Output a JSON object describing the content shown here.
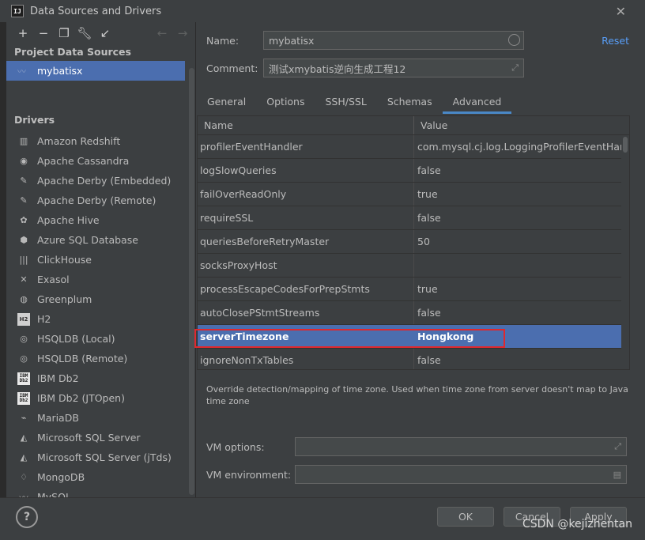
{
  "window": {
    "title": "Data Sources and Drivers",
    "app_icon": "IJ"
  },
  "toolbar": {
    "icons": [
      "add-icon",
      "remove-icon",
      "duplicate-icon",
      "wrench-icon",
      "import-icon",
      "back-icon",
      "forward-icon"
    ]
  },
  "sidebar": {
    "project_heading": "Project Data Sources",
    "data_source": "mybatisx",
    "drivers_heading": "Drivers",
    "drivers": [
      {
        "label": "Amazon Redshift",
        "icon": "redshift-icon"
      },
      {
        "label": "Apache Cassandra",
        "icon": "cassandra-icon"
      },
      {
        "label": "Apache Derby (Embedded)",
        "icon": "derby-icon"
      },
      {
        "label": "Apache Derby (Remote)",
        "icon": "derby-icon"
      },
      {
        "label": "Apache Hive",
        "icon": "hive-icon"
      },
      {
        "label": "Azure SQL Database",
        "icon": "azure-icon"
      },
      {
        "label": "ClickHouse",
        "icon": "clickhouse-icon"
      },
      {
        "label": "Exasol",
        "icon": "exasol-icon"
      },
      {
        "label": "Greenplum",
        "icon": "greenplum-icon"
      },
      {
        "label": "H2",
        "icon": "h2-icon"
      },
      {
        "label": "HSQLDB (Local)",
        "icon": "hsqldb-icon"
      },
      {
        "label": "HSQLDB (Remote)",
        "icon": "hsqldb-icon"
      },
      {
        "label": "IBM Db2",
        "icon": "ibm-db2-icon"
      },
      {
        "label": "IBM Db2 (JTOpen)",
        "icon": "ibm-db2-icon"
      },
      {
        "label": "MariaDB",
        "icon": "mariadb-icon"
      },
      {
        "label": "Microsoft SQL Server",
        "icon": "mssql-icon"
      },
      {
        "label": "Microsoft SQL Server (jTds)",
        "icon": "mssql-icon"
      },
      {
        "label": "MongoDB",
        "icon": "mongodb-icon"
      },
      {
        "label": "MySQL",
        "icon": "mysql-icon"
      }
    ]
  },
  "form": {
    "name_label": "Name:",
    "name_value": "mybatisx",
    "comment_label": "Comment:",
    "comment_value": "测试xmybatis逆向生成工程12",
    "reset_label": "Reset"
  },
  "tabs": [
    {
      "label": "General",
      "active": false
    },
    {
      "label": "Options",
      "active": false
    },
    {
      "label": "SSH/SSL",
      "active": false
    },
    {
      "label": "Schemas",
      "active": false
    },
    {
      "label": "Advanced",
      "active": true
    }
  ],
  "properties": {
    "columns": [
      "Name",
      "Value"
    ],
    "rows": [
      {
        "name": "profilerEventHandler",
        "value": "com.mysql.cj.log.LoggingProfilerEventHandler"
      },
      {
        "name": "logSlowQueries",
        "value": "false"
      },
      {
        "name": "failOverReadOnly",
        "value": "true"
      },
      {
        "name": "requireSSL",
        "value": "false"
      },
      {
        "name": "queriesBeforeRetryMaster",
        "value": "50"
      },
      {
        "name": "socksProxyHost",
        "value": ""
      },
      {
        "name": "processEscapeCodesForPrepStmts",
        "value": "true"
      },
      {
        "name": "autoClosePStmtStreams",
        "value": "false"
      },
      {
        "name": "serverTimezone",
        "value": "Hongkong",
        "selected": true
      },
      {
        "name": "ignoreNonTxTables",
        "value": "false"
      }
    ]
  },
  "description": "Override detection/mapping of time zone. Used when time zone from server doesn't map to Java time zone",
  "vm": {
    "options_label": "VM options:",
    "options_value": "",
    "environment_label": "VM environment:",
    "environment_value": ""
  },
  "footer": {
    "help_label": "?",
    "ok_label": "OK",
    "cancel_label": "Cancel",
    "apply_label": "Apply",
    "watermark": "CSDN @kejizhentan"
  },
  "colors": {
    "background": "#3c3f41",
    "selection": "#4b6eaf",
    "link": "#589df6",
    "highlight_box": "#e0282e"
  }
}
